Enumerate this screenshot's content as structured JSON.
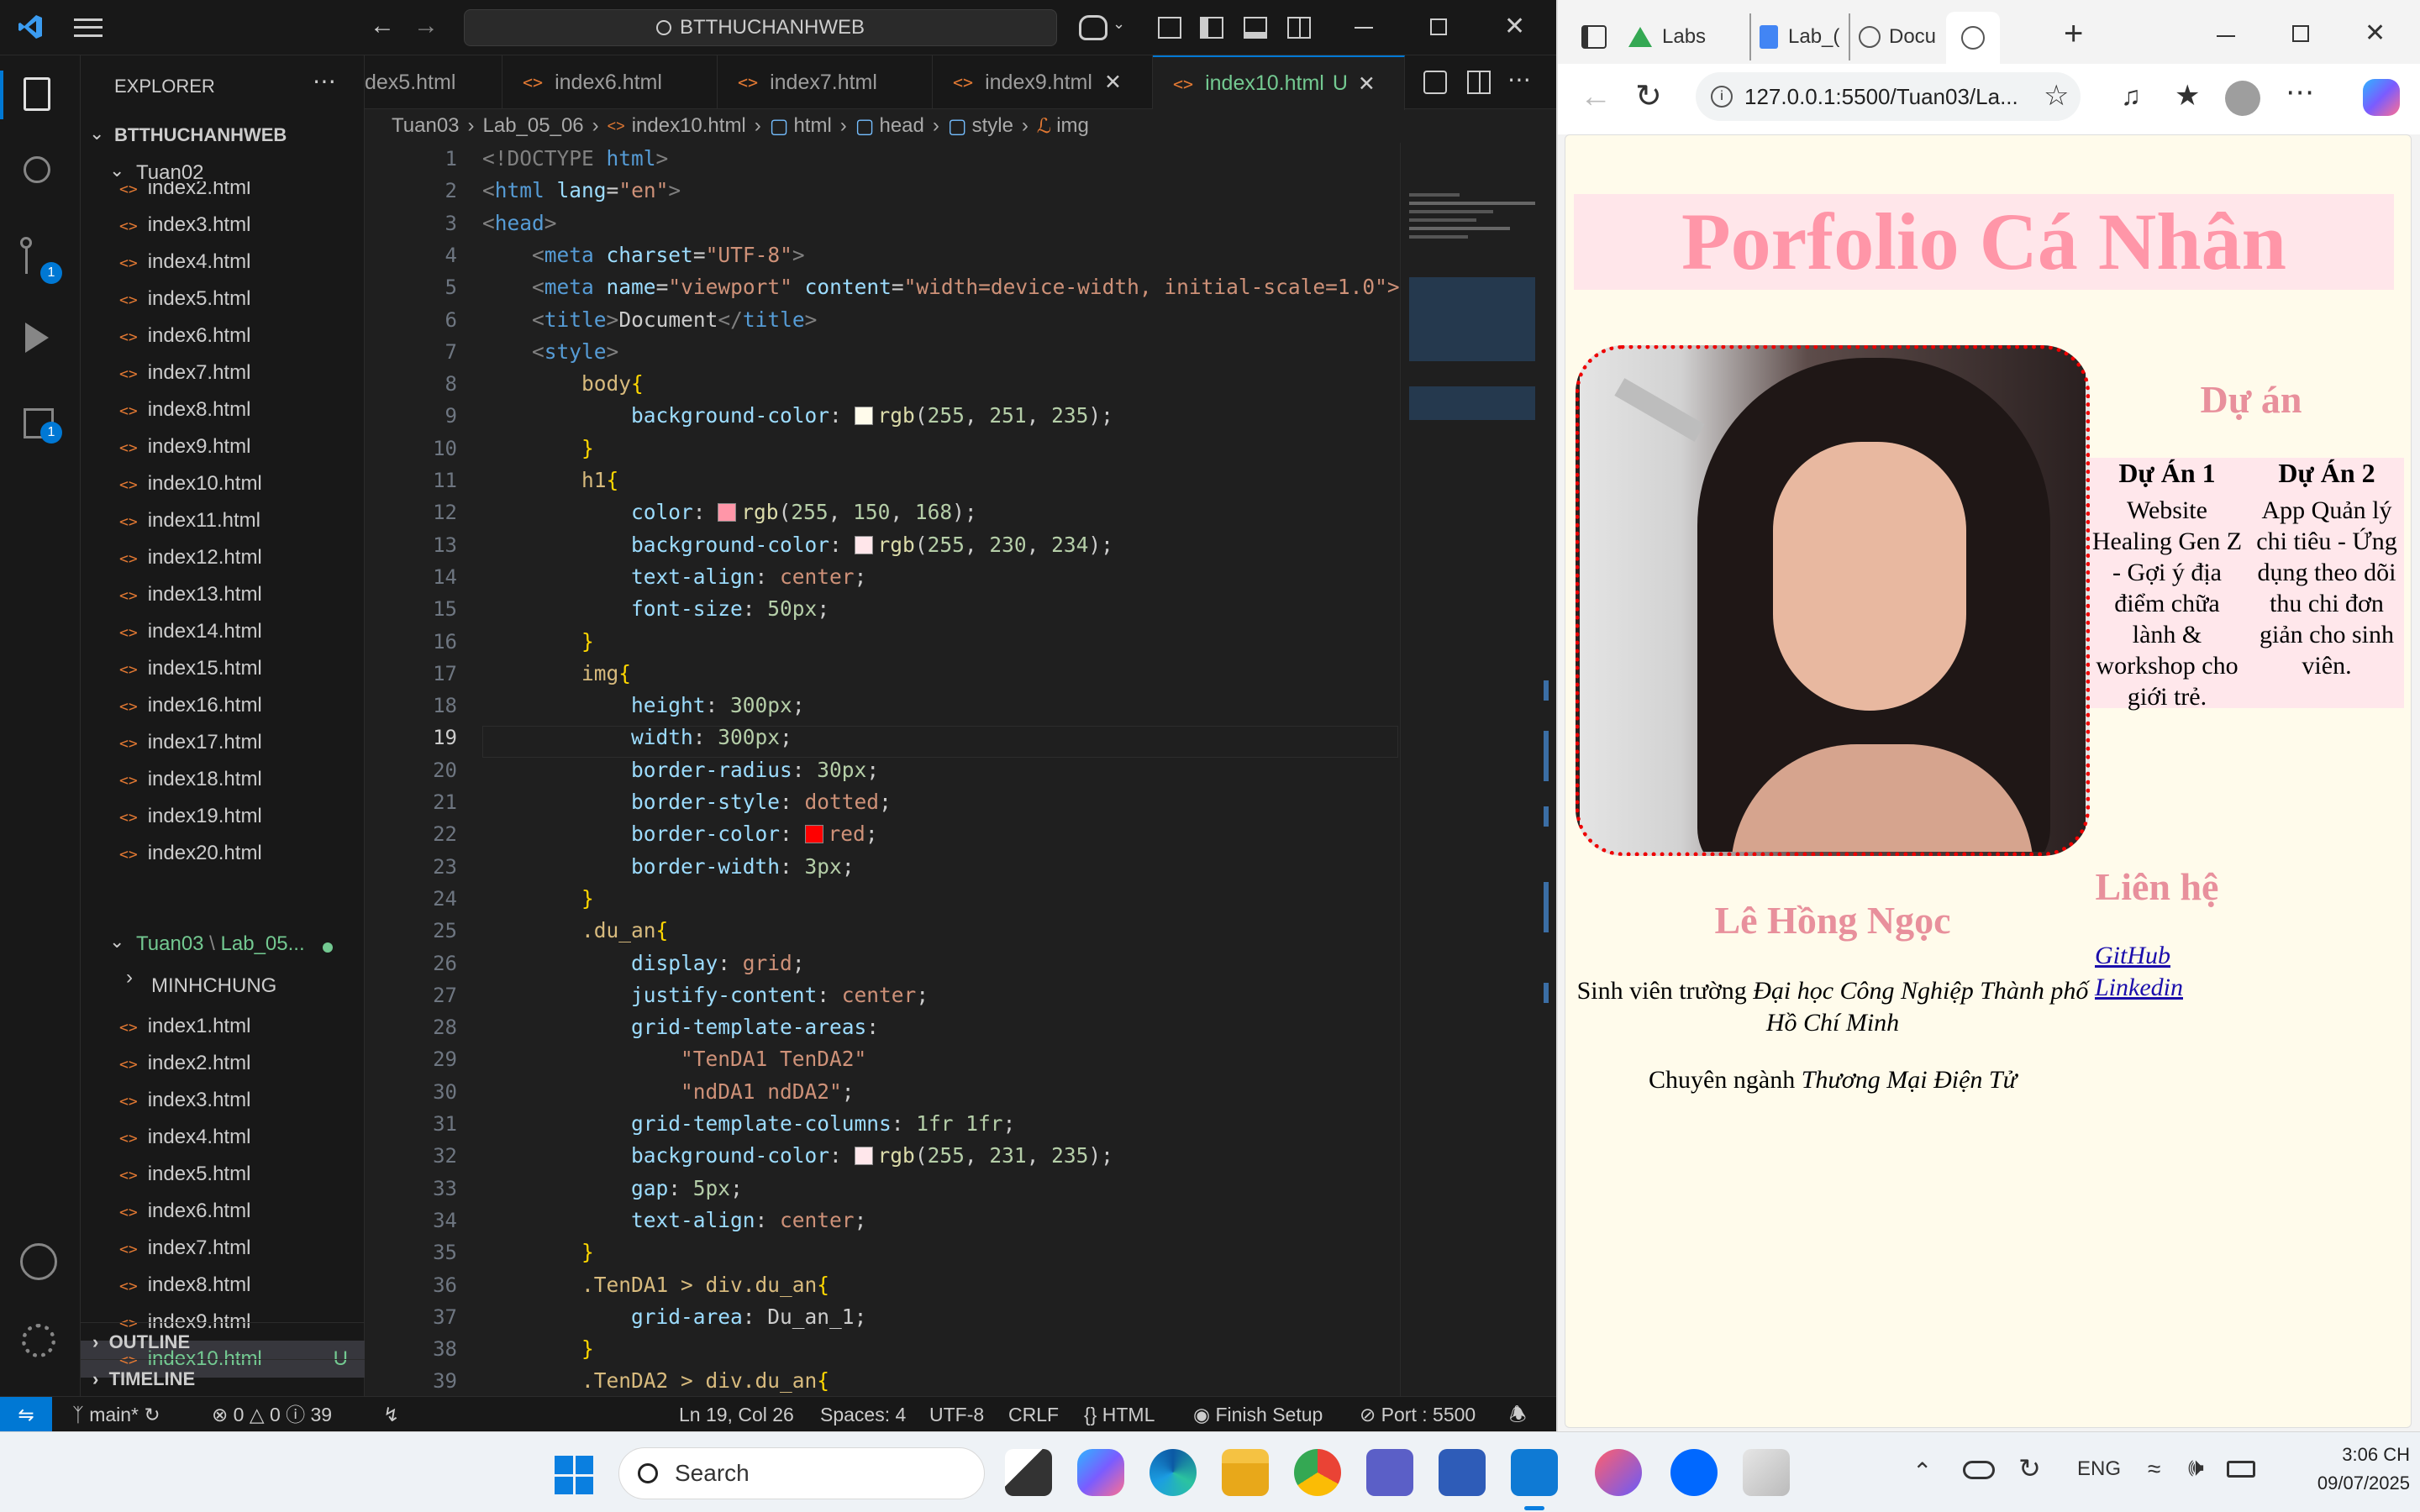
{
  "vscode": {
    "search": "BTTHUCHANHWEB",
    "explorer_title": "EXPLORER",
    "root_folder": "BTTHUCHANHWEB",
    "tuan02": "Tuan02",
    "tuan02_files": [
      "index2.html",
      "index3.html",
      "index4.html",
      "index5.html",
      "index6.html",
      "index7.html",
      "index8.html",
      "index9.html",
      "index10.html",
      "index11.html",
      "index12.html",
      "index13.html",
      "index14.html",
      "index15.html",
      "index16.html",
      "index17.html",
      "index18.html",
      "index19.html",
      "index20.html"
    ],
    "tuan03": "Tuan03",
    "tuan03_sub": "Lab_05...",
    "minhchung": "MINHCHUNG",
    "tuan03_files": [
      "index1.html",
      "index2.html",
      "index3.html",
      "index4.html",
      "index5.html",
      "index6.html",
      "index7.html",
      "index8.html",
      "index9.html",
      "index10.html"
    ],
    "active_file_badge": "U",
    "outline": "OUTLINE",
    "timeline": "TIMELINE",
    "tabs": [
      "dex5.html",
      "index6.html",
      "index7.html",
      "index9.html",
      "index10.html"
    ],
    "active_tab_badge": "U",
    "breadcrumb": [
      "Tuan03",
      "Lab_05_06",
      "index10.html",
      "html",
      "head",
      "style",
      "img"
    ],
    "line_numbers": [
      "1",
      "2",
      "3",
      "4",
      "5",
      "6",
      "7",
      "8",
      "9",
      "10",
      "11",
      "12",
      "13",
      "14",
      "15",
      "16",
      "17",
      "18",
      "19",
      "20",
      "21",
      "22",
      "23",
      "24",
      "25",
      "26",
      "27",
      "28",
      "29",
      "30",
      "31",
      "32",
      "33",
      "34",
      "35",
      "36",
      "37",
      "38",
      "39"
    ],
    "activity_badges": [
      "1",
      "1"
    ],
    "status": {
      "branch": "main*",
      "problems": "0",
      "warnings": "0",
      "info": "39",
      "position": "Ln 19, Col 26",
      "spaces": "Spaces: 4",
      "encoding": "UTF-8",
      "eol": "CRLF",
      "language": "HTML",
      "setup": "Finish Setup",
      "port": "Port : 5500"
    },
    "colors": {
      "accent": "#0078d4",
      "tree_active": "#73c991"
    }
  },
  "code_lines": [
    [
      [
        "<!DOCTYPE ",
        "#808080"
      ],
      [
        "html",
        "#569cd6"
      ],
      [
        ">",
        "#808080"
      ]
    ],
    [
      [
        "<",
        "#808080"
      ],
      [
        "html ",
        "#569cd6"
      ],
      [
        "lang",
        "#9cdcfe"
      ],
      [
        "=",
        "#ccc"
      ],
      [
        "\"en\"",
        "#ce9178"
      ],
      [
        ">",
        "#808080"
      ]
    ],
    [
      [
        "<",
        "#808080"
      ],
      [
        "head",
        "#569cd6"
      ],
      [
        ">",
        "#808080"
      ]
    ],
    [
      [
        "    ",
        ""
      ],
      [
        "<",
        "#808080"
      ],
      [
        "meta ",
        "#569cd6"
      ],
      [
        "charset",
        "#9cdcfe"
      ],
      [
        "=",
        "#ccc"
      ],
      [
        "\"UTF-8\"",
        "#ce9178"
      ],
      [
        ">",
        "#808080"
      ]
    ],
    [
      [
        "    ",
        ""
      ],
      [
        "<",
        "#808080"
      ],
      [
        "meta ",
        "#569cd6"
      ],
      [
        "name",
        "#9cdcfe"
      ],
      [
        "=",
        "#ccc"
      ],
      [
        "\"viewport\" ",
        "#ce9178"
      ],
      [
        "content",
        "#9cdcfe"
      ],
      [
        "=",
        "#ccc"
      ],
      [
        "\"width=device-width, initial-scale=1.0\">",
        "#ce9178"
      ]
    ],
    [
      [
        "    ",
        ""
      ],
      [
        "<",
        "#808080"
      ],
      [
        "title",
        "#569cd6"
      ],
      [
        ">",
        "#808080"
      ],
      [
        "Document",
        "#ccc"
      ],
      [
        "</",
        "#808080"
      ],
      [
        "title",
        "#569cd6"
      ],
      [
        ">",
        "#808080"
      ]
    ],
    [
      [
        "    ",
        ""
      ],
      [
        "<",
        "#808080"
      ],
      [
        "style",
        "#569cd6"
      ],
      [
        ">",
        "#808080"
      ]
    ],
    [
      [
        "        ",
        ""
      ],
      [
        "body",
        "#d7ba7d"
      ],
      [
        "{",
        "#ffd700"
      ]
    ],
    [
      [
        "            ",
        ""
      ],
      [
        "background-color",
        "#9cdcfe"
      ],
      [
        ": ",
        "#ccc"
      ],
      [
        "SW:#fffbeb",
        ""
      ],
      [
        "rgb",
        "#dcdcaa"
      ],
      [
        "(",
        "#ccc"
      ],
      [
        "255",
        "#b5cea8"
      ],
      [
        ", ",
        "#ccc"
      ],
      [
        "251",
        "#b5cea8"
      ],
      [
        ", ",
        "#ccc"
      ],
      [
        "235",
        "#b5cea8"
      ],
      [
        ");",
        "#ccc"
      ]
    ],
    [
      [
        "        ",
        ""
      ],
      [
        "}",
        "#ffd700"
      ]
    ],
    [
      [
        "        ",
        ""
      ],
      [
        "h1",
        "#d7ba7d"
      ],
      [
        "{",
        "#ffd700"
      ]
    ],
    [
      [
        "            ",
        ""
      ],
      [
        "color",
        "#9cdcfe"
      ],
      [
        ": ",
        "#ccc"
      ],
      [
        "SW:#ff96a8",
        ""
      ],
      [
        "rgb",
        "#dcdcaa"
      ],
      [
        "(",
        "#ccc"
      ],
      [
        "255",
        "#b5cea8"
      ],
      [
        ", ",
        "#ccc"
      ],
      [
        "150",
        "#b5cea8"
      ],
      [
        ", ",
        "#ccc"
      ],
      [
        "168",
        "#b5cea8"
      ],
      [
        ");",
        "#ccc"
      ]
    ],
    [
      [
        "            ",
        ""
      ],
      [
        "background-color",
        "#9cdcfe"
      ],
      [
        ": ",
        "#ccc"
      ],
      [
        "SW:#ffe6ea",
        ""
      ],
      [
        "rgb",
        "#dcdcaa"
      ],
      [
        "(",
        "#ccc"
      ],
      [
        "255",
        "#b5cea8"
      ],
      [
        ", ",
        "#ccc"
      ],
      [
        "230",
        "#b5cea8"
      ],
      [
        ", ",
        "#ccc"
      ],
      [
        "234",
        "#b5cea8"
      ],
      [
        ");",
        "#ccc"
      ]
    ],
    [
      [
        "            ",
        ""
      ],
      [
        "text-align",
        "#9cdcfe"
      ],
      [
        ": ",
        "#ccc"
      ],
      [
        "center",
        "#ce9178"
      ],
      [
        ";",
        "#ccc"
      ]
    ],
    [
      [
        "            ",
        ""
      ],
      [
        "font-size",
        "#9cdcfe"
      ],
      [
        ": ",
        "#ccc"
      ],
      [
        "50px",
        "#b5cea8"
      ],
      [
        ";",
        "#ccc"
      ]
    ],
    [
      [
        "        ",
        ""
      ],
      [
        "}",
        "#ffd700"
      ]
    ],
    [
      [
        "        ",
        ""
      ],
      [
        "img",
        "#d7ba7d"
      ],
      [
        "{",
        "#ffd700"
      ]
    ],
    [
      [
        "            ",
        ""
      ],
      [
        "height",
        "#9cdcfe"
      ],
      [
        ": ",
        "#ccc"
      ],
      [
        "300px",
        "#b5cea8"
      ],
      [
        ";",
        "#ccc"
      ]
    ],
    [
      [
        "            ",
        ""
      ],
      [
        "width",
        "#9cdcfe"
      ],
      [
        ": ",
        "#ccc"
      ],
      [
        "300px",
        "#b5cea8"
      ],
      [
        ";",
        "#ccc"
      ]
    ],
    [
      [
        "            ",
        ""
      ],
      [
        "border-radius",
        "#9cdcfe"
      ],
      [
        ": ",
        "#ccc"
      ],
      [
        "30px",
        "#b5cea8"
      ],
      [
        ";",
        "#ccc"
      ]
    ],
    [
      [
        "            ",
        ""
      ],
      [
        "border-style",
        "#9cdcfe"
      ],
      [
        ": ",
        "#ccc"
      ],
      [
        "dotted",
        "#ce9178"
      ],
      [
        ";",
        "#ccc"
      ]
    ],
    [
      [
        "            ",
        ""
      ],
      [
        "border-color",
        "#9cdcfe"
      ],
      [
        ": ",
        "#ccc"
      ],
      [
        "SW:#ff0000",
        ""
      ],
      [
        "red",
        "#ce9178"
      ],
      [
        ";",
        "#ccc"
      ]
    ],
    [
      [
        "            ",
        ""
      ],
      [
        "border-width",
        "#9cdcfe"
      ],
      [
        ": ",
        "#ccc"
      ],
      [
        "3px",
        "#b5cea8"
      ],
      [
        ";",
        "#ccc"
      ]
    ],
    [
      [
        "        ",
        ""
      ],
      [
        "}",
        "#ffd700"
      ]
    ],
    [
      [
        "        ",
        ""
      ],
      [
        ".du_an",
        "#d7ba7d"
      ],
      [
        "{",
        "#ffd700"
      ]
    ],
    [
      [
        "            ",
        ""
      ],
      [
        "display",
        "#9cdcfe"
      ],
      [
        ": ",
        "#ccc"
      ],
      [
        "grid",
        "#ce9178"
      ],
      [
        ";",
        "#ccc"
      ]
    ],
    [
      [
        "            ",
        ""
      ],
      [
        "justify-content",
        "#9cdcfe"
      ],
      [
        ": ",
        "#ccc"
      ],
      [
        "center",
        "#ce9178"
      ],
      [
        ";",
        "#ccc"
      ]
    ],
    [
      [
        "            ",
        ""
      ],
      [
        "grid-template-areas",
        "#9cdcfe"
      ],
      [
        ":",
        "#ccc"
      ]
    ],
    [
      [
        "                ",
        ""
      ],
      [
        "\"TenDA1 TenDA2\"",
        "#ce9178"
      ]
    ],
    [
      [
        "                ",
        ""
      ],
      [
        "\"ndDA1 ndDA2\"",
        "#ce9178"
      ],
      [
        ";",
        "#ccc"
      ]
    ],
    [
      [
        "            ",
        ""
      ],
      [
        "grid-template-columns",
        "#9cdcfe"
      ],
      [
        ": ",
        "#ccc"
      ],
      [
        "1fr 1fr",
        "#b5cea8"
      ],
      [
        ";",
        "#ccc"
      ]
    ],
    [
      [
        "            ",
        ""
      ],
      [
        "background-color",
        "#9cdcfe"
      ],
      [
        ": ",
        "#ccc"
      ],
      [
        "SW:#ffe7eb",
        ""
      ],
      [
        "rgb",
        "#dcdcaa"
      ],
      [
        "(",
        "#ccc"
      ],
      [
        "255",
        "#b5cea8"
      ],
      [
        ", ",
        "#ccc"
      ],
      [
        "231",
        "#b5cea8"
      ],
      [
        ", ",
        "#ccc"
      ],
      [
        "235",
        "#b5cea8"
      ],
      [
        ");",
        "#ccc"
      ]
    ],
    [
      [
        "            ",
        ""
      ],
      [
        "gap",
        "#9cdcfe"
      ],
      [
        ": ",
        "#ccc"
      ],
      [
        "5px",
        "#b5cea8"
      ],
      [
        ";",
        "#ccc"
      ]
    ],
    [
      [
        "            ",
        ""
      ],
      [
        "text-align",
        "#9cdcfe"
      ],
      [
        ": ",
        "#ccc"
      ],
      [
        "center",
        "#ce9178"
      ],
      [
        ";",
        "#ccc"
      ]
    ],
    [
      [
        "        ",
        ""
      ],
      [
        "}",
        "#ffd700"
      ]
    ],
    [
      [
        "        ",
        ""
      ],
      [
        ".TenDA1 > div.du_an",
        "#d7ba7d"
      ],
      [
        "{",
        "#ffd700"
      ]
    ],
    [
      [
        "            ",
        ""
      ],
      [
        "grid-area",
        "#9cdcfe"
      ],
      [
        ": ",
        "#ccc"
      ],
      [
        "Du_an_1",
        "#ccc"
      ],
      [
        ";",
        "#ccc"
      ]
    ],
    [
      [
        "        ",
        ""
      ],
      [
        "}",
        "#ffd700"
      ]
    ],
    [
      [
        "        ",
        ""
      ],
      [
        ".TenDA2 > div.du_an",
        "#d7ba7d"
      ],
      [
        "{",
        "#ffd700"
      ]
    ]
  ],
  "browser": {
    "tabs": [
      "Labs",
      "Lab_(",
      "Docu"
    ],
    "address": "127.0.0.1:5500/Tuan03/La...",
    "page": {
      "title": "Porfolio Cá Nhân",
      "name": "Lê Hồng Ngọc",
      "bio_prefix": "Sinh viên trường ",
      "bio_school": "Đại học Công Nghiệp Thành phố Hồ Chí Minh",
      "major_prefix": "Chuyên ngành ",
      "major": "Thương Mại Điện Tử",
      "projects_heading": "Dự án",
      "project1_title": "Dự Án 1",
      "project1_desc": "Website Healing Gen Z - Gợi ý địa điểm chữa lành & workshop cho giới trẻ.",
      "project2_title": "Dự Án 2",
      "project2_desc": "App Quản lý chi tiêu - Ứng dụng theo dõi thu chi đơn giản cho sinh viên.",
      "contact_heading": "Liên hệ",
      "link1": "GitHub",
      "link2": "Linkedin"
    },
    "colors": {
      "page_bg": "#fffbeb",
      "h1": "#ff96a8",
      "h1_bg": "#ffe6ea",
      "grid_bg": "#ffe7eb",
      "border": "#ff0000",
      "heading": "#e8909c"
    }
  },
  "taskbar": {
    "search": "Search",
    "lang": "ENG",
    "time": "3:06 CH",
    "date": "09/07/2025"
  }
}
